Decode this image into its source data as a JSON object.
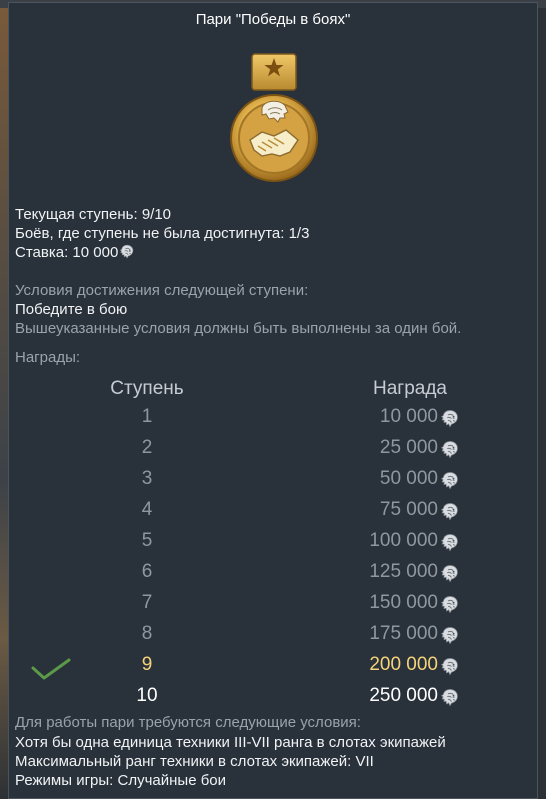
{
  "title": "Пари \"Победы в боях\"",
  "medal_icon": "gold-medal-handshake-lion-icon",
  "status": {
    "current_step_label": "Текущая ступень:",
    "current_step_value": "9/10",
    "battles_label": "Боёв, где ступень не была достигнута:",
    "battles_value": "1/3",
    "bet_label": "Ставка:",
    "bet_value": "10 000"
  },
  "conditions": {
    "heading": "Условия достижения следующей ступени:",
    "task": "Победите в бою",
    "note": "Вышеуказанные условия должны быть выполнены за один бой."
  },
  "rewards": {
    "heading": "Награды:",
    "col_step": "Ступень",
    "col_reward": "Награда",
    "rows": [
      {
        "step": "1",
        "reward": "10 000"
      },
      {
        "step": "2",
        "reward": "25 000"
      },
      {
        "step": "3",
        "reward": "50 000"
      },
      {
        "step": "4",
        "reward": "75 000"
      },
      {
        "step": "5",
        "reward": "100 000"
      },
      {
        "step": "6",
        "reward": "125 000"
      },
      {
        "step": "7",
        "reward": "150 000"
      },
      {
        "step": "8",
        "reward": "175 000"
      },
      {
        "step": "9",
        "reward": "200 000"
      },
      {
        "step": "10",
        "reward": "250 000"
      }
    ],
    "current_step_index": 8,
    "currency_icon": "silver-lion-icon"
  },
  "requirements": {
    "heading": "Для работы пари требуются следующие условия:",
    "line1_label": "Хотя бы одна единица техники",
    "line1_value": "III-VII",
    "line1_suffix": "ранга в слотах экипажей",
    "line2_label": "Максимальный ранг техники в слотах экипажей:",
    "line2_value": "VII",
    "line3_label": "Режимы игры:",
    "line3_value": "Случайные бои"
  },
  "colors": {
    "panel_bg": "#29313a",
    "highlight": "#f5d37a",
    "muted": "#9aa3ab",
    "check": "#5a9a48"
  }
}
